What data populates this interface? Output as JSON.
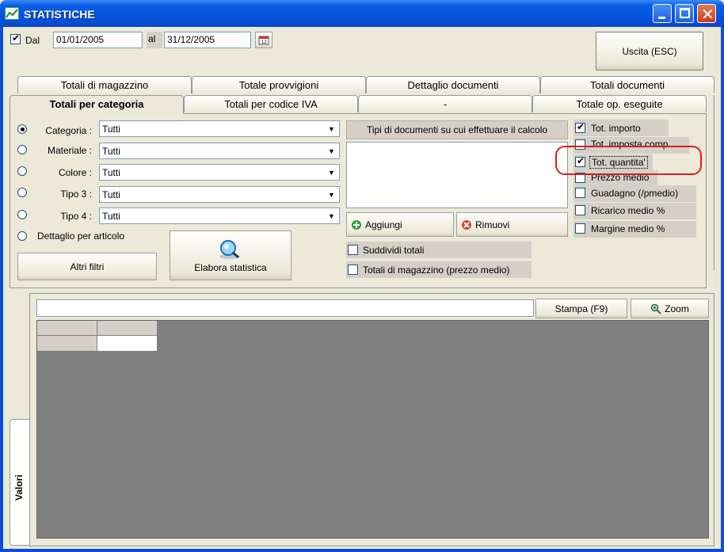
{
  "window": {
    "title": "STATISTICHE"
  },
  "date_range": {
    "dal_label": "Dal",
    "dal_checked": true,
    "from": "01/01/2005",
    "al_label": "al",
    "to": "31/12/2005"
  },
  "exit_button": "Uscita (ESC)",
  "tabs_row1": [
    "Totali di magazzino",
    "Totale provvigioni",
    "Dettaglio documenti",
    "Totali documenti"
  ],
  "tabs_row2": [
    "Totali per categoria",
    "Totali per codice IVA",
    "-",
    "Totale op. eseguite"
  ],
  "filters": [
    {
      "label": "Categoria :",
      "value": "Tutti",
      "selected": true
    },
    {
      "label": "Materiale :",
      "value": "Tutti",
      "selected": false
    },
    {
      "label": "Colore :",
      "value": "Tutti",
      "selected": false
    },
    {
      "label": "Tipo 3 :",
      "value": "Tutti",
      "selected": false
    },
    {
      "label": "Tipo 4 :",
      "value": "Tutti",
      "selected": false
    }
  ],
  "detail_article": "Dettaglio per articolo",
  "other_filters": "Altri filtri",
  "process_button": "Elabora statistica",
  "doc_types_header": "Tipi di documenti su cui effettuare il calcolo",
  "add_button": "Aggiungi",
  "remove_button": "Rimuovi",
  "subdivide_totals": "Suddividi totali",
  "warehouse_totals": "Totali di magazzino (prezzo medio)",
  "totals": [
    {
      "label": "Tot. importo",
      "checked": true
    },
    {
      "label": "Tot. imposta comp.",
      "checked": false
    },
    {
      "label": "Tot. quantita'",
      "checked": true
    },
    {
      "label": "Prezzo medio",
      "checked": false
    },
    {
      "label": "Guadagno (/pmedio)",
      "checked": false
    },
    {
      "label": "Ricarico medio %",
      "checked": false
    },
    {
      "label": "Margine medio %",
      "checked": false
    }
  ],
  "print_button": "Stampa (F9)",
  "zoom_button": "Zoom",
  "side_tab": "Valori",
  "colors": {
    "highlight": "#d42020",
    "grid_bg": "#808080"
  }
}
